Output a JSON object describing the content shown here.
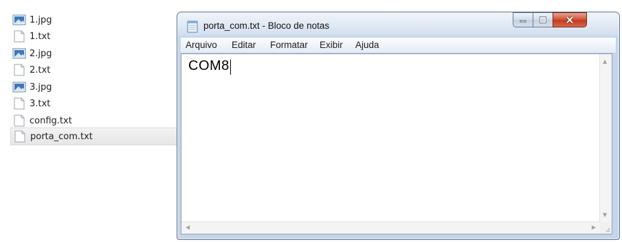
{
  "explorer": {
    "files": [
      {
        "name": "1.jpg",
        "type": "image"
      },
      {
        "name": "1.txt",
        "type": "text"
      },
      {
        "name": "2.jpg",
        "type": "image"
      },
      {
        "name": "2.txt",
        "type": "text"
      },
      {
        "name": "3.jpg",
        "type": "image"
      },
      {
        "name": "3.txt",
        "type": "text"
      },
      {
        "name": "config.txt",
        "type": "text"
      },
      {
        "name": "porta_com.txt",
        "type": "text",
        "selected": true
      }
    ]
  },
  "notepad": {
    "title": "porta_com.txt - Bloco de notas",
    "menu": [
      "Arquivo",
      "Editar",
      "Formatar",
      "Exibir",
      "Ajuda"
    ],
    "content": "COM8"
  }
}
